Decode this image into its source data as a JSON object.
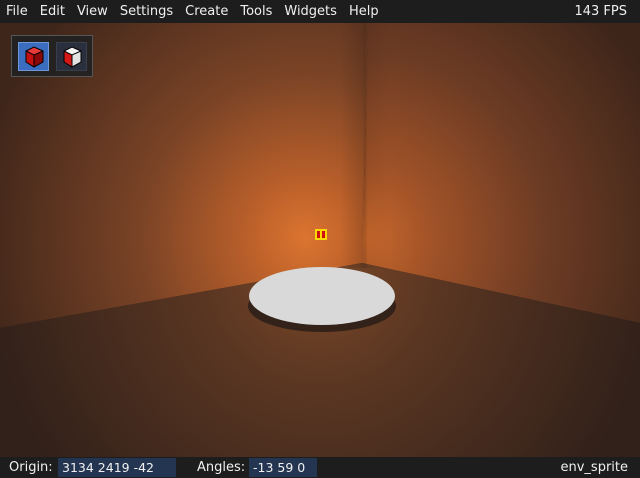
{
  "menubar": {
    "items": [
      "File",
      "Edit",
      "View",
      "Settings",
      "Create",
      "Tools",
      "Widgets",
      "Help"
    ],
    "fps": "143 FPS"
  },
  "toolbar": {
    "tools": [
      {
        "icon": "entity-cube-icon",
        "active": true
      },
      {
        "icon": "brush-cube-icon",
        "active": false
      }
    ]
  },
  "statusbar": {
    "origin_label": "Origin:",
    "origin_value": "3134 2419 -42",
    "angles_label": "Angles:",
    "angles_value": "-13 59 0",
    "selected_class": "env_sprite"
  },
  "colors": {
    "menu_bg": "#1d1d1d",
    "field_bg": "#243552",
    "active_tool": "#3a6cc0",
    "wall_light": "#d9742f",
    "wall_dark": "#3c2519",
    "floor": "#4a3020",
    "platform": "#dcdcdc"
  }
}
